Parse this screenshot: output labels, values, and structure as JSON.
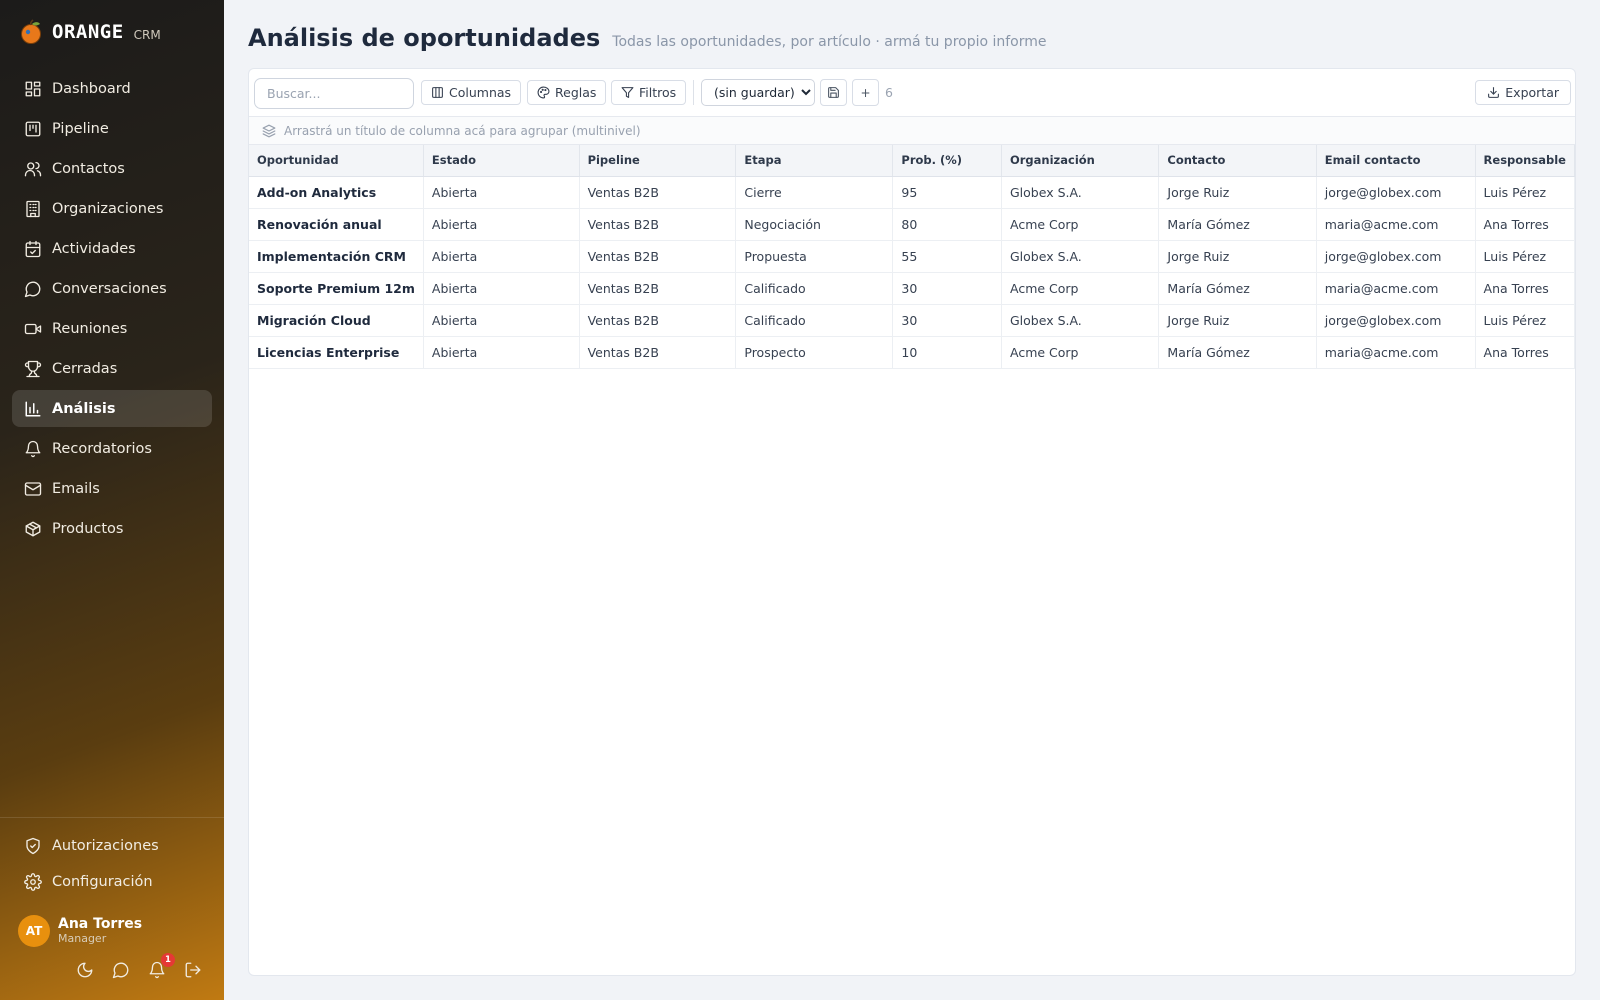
{
  "brand": {
    "name": "ORANGE",
    "sub": "CRM"
  },
  "nav": {
    "items": [
      {
        "label": "Dashboard",
        "icon": "dashboard-icon"
      },
      {
        "label": "Pipeline",
        "icon": "kanban-icon"
      },
      {
        "label": "Contactos",
        "icon": "users-icon"
      },
      {
        "label": "Organizaciones",
        "icon": "building-icon"
      },
      {
        "label": "Actividades",
        "icon": "calendar-check-icon"
      },
      {
        "label": "Conversaciones",
        "icon": "chat-icon"
      },
      {
        "label": "Reuniones",
        "icon": "video-icon"
      },
      {
        "label": "Cerradas",
        "icon": "trophy-icon"
      },
      {
        "label": "Análisis",
        "icon": "bar-chart-icon",
        "active": true
      },
      {
        "label": "Recordatorios",
        "icon": "bell-icon"
      },
      {
        "label": "Emails",
        "icon": "mail-icon"
      },
      {
        "label": "Productos",
        "icon": "box-icon"
      }
    ],
    "bottom": [
      {
        "label": "Autorizaciones",
        "icon": "shield-check-icon"
      },
      {
        "label": "Configuración",
        "icon": "gear-icon"
      }
    ]
  },
  "user": {
    "initials": "AT",
    "name": "Ana Torres",
    "role": "Manager",
    "notifications": "1"
  },
  "header": {
    "title": "Análisis de oportunidades",
    "subtitle": "Todas las oportunidades, por artículo · armá tu propio informe"
  },
  "toolbar": {
    "search_placeholder": "Buscar...",
    "columns_label": "Columnas",
    "rules_label": "Reglas",
    "filters_label": "Filtros",
    "view_selected": "(sin guardar)",
    "add_label": "+",
    "count": "6",
    "export_label": "Exportar"
  },
  "group_hint": "Arrastrá un título de columna acá para agrupar (multinivel)",
  "table": {
    "columns": [
      "Oportunidad",
      "Estado",
      "Pipeline",
      "Etapa",
      "Prob. (%)",
      "Organización",
      "Contacto",
      "Email contacto",
      "Responsable"
    ],
    "rows": [
      [
        "Add-on Analytics",
        "Abierta",
        "Ventas B2B",
        "Cierre",
        "95",
        "Globex S.A.",
        "Jorge Ruiz",
        "jorge@globex.com",
        "Luis Pérez"
      ],
      [
        "Renovación anual",
        "Abierta",
        "Ventas B2B",
        "Negociación",
        "80",
        "Acme Corp",
        "María Gómez",
        "maria@acme.com",
        "Ana Torres"
      ],
      [
        "Implementación CRM",
        "Abierta",
        "Ventas B2B",
        "Propuesta",
        "55",
        "Globex S.A.",
        "Jorge Ruiz",
        "jorge@globex.com",
        "Luis Pérez"
      ],
      [
        "Soporte Premium 12m",
        "Abierta",
        "Ventas B2B",
        "Calificado",
        "30",
        "Acme Corp",
        "María Gómez",
        "maria@acme.com",
        "Ana Torres"
      ],
      [
        "Migración Cloud",
        "Abierta",
        "Ventas B2B",
        "Calificado",
        "30",
        "Globex S.A.",
        "Jorge Ruiz",
        "jorge@globex.com",
        "Luis Pérez"
      ],
      [
        "Licencias Enterprise",
        "Abierta",
        "Ventas B2B",
        "Prospecto",
        "10",
        "Acme Corp",
        "María Gómez",
        "maria@acme.com",
        "Ana Torres"
      ]
    ]
  }
}
